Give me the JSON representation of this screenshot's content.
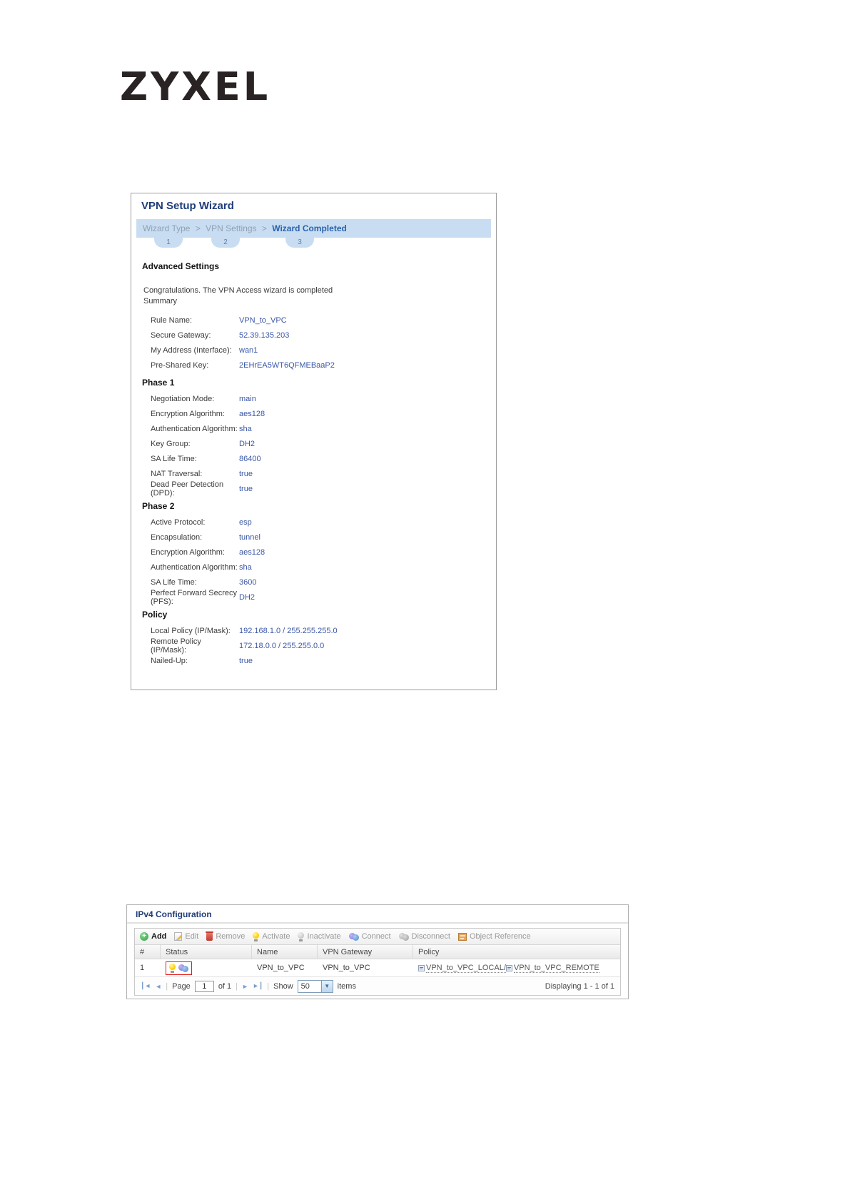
{
  "logo_text": "ZYXEL",
  "colors": {
    "title_navy": "#1e3c78",
    "breadcrumb_bg": "#c8ddf2",
    "breadcrumb_current": "#2a62ac",
    "value_blue": "#3a57a7",
    "status_highlight_red": "#e21b1b"
  },
  "wizard": {
    "title": "VPN Setup Wizard",
    "breadcrumb": {
      "item1": "Wizard Type",
      "item2": "VPN Settings",
      "current": "Wizard Completed",
      "separator": ">"
    },
    "steps": [
      "1",
      "2",
      "3"
    ],
    "advanced_heading": "Advanced Settings",
    "congrats_line1": "Congratulations. The VPN Access wizard is completed",
    "congrats_line2": "Summary",
    "summary": [
      {
        "label": "Rule Name:",
        "value": "VPN_to_VPC"
      },
      {
        "label": "Secure Gateway:",
        "value": "52.39.135.203"
      },
      {
        "label": "My Address (Interface):",
        "value": "wan1"
      },
      {
        "label": "Pre-Shared Key:",
        "value": "2EHrEA5WT6QFMEBaaP2"
      }
    ],
    "phase1": {
      "title": "Phase 1",
      "rows": [
        {
          "label": "Negotiation Mode:",
          "value": "main"
        },
        {
          "label": "Encryption Algorithm:",
          "value": "aes128"
        },
        {
          "label": "Authentication Algorithm:",
          "value": "sha"
        },
        {
          "label": "Key Group:",
          "value": "DH2"
        },
        {
          "label": "SA Life Time:",
          "value": "86400"
        },
        {
          "label": "NAT Traversal:",
          "value": "true"
        },
        {
          "label": "Dead Peer Detection (DPD):",
          "value": "true"
        }
      ]
    },
    "phase2": {
      "title": "Phase 2",
      "rows": [
        {
          "label": "Active Protocol:",
          "value": "esp"
        },
        {
          "label": "Encapsulation:",
          "value": "tunnel"
        },
        {
          "label": "Encryption Algorithm:",
          "value": "aes128"
        },
        {
          "label": "Authentication Algorithm:",
          "value": "sha"
        },
        {
          "label": "SA Life Time:",
          "value": "3600"
        },
        {
          "label": "Perfect Forward Secrecy (PFS):",
          "value": "DH2"
        }
      ]
    },
    "policy": {
      "title": "Policy",
      "rows": [
        {
          "label": "Local Policy (IP/Mask):",
          "value": "192.168.1.0 / 255.255.255.0"
        },
        {
          "label": "Remote Policy (IP/Mask):",
          "value": "172.18.0.0 / 255.255.0.0"
        },
        {
          "label": "Nailed-Up:",
          "value": "true"
        }
      ]
    }
  },
  "ipv4": {
    "title": "IPv4 Configuration",
    "toolbar": [
      {
        "label": "Add",
        "icon": "add-icon",
        "enabled": true
      },
      {
        "label": "Edit",
        "icon": "edit-icon",
        "enabled": false
      },
      {
        "label": "Remove",
        "icon": "trash-icon",
        "enabled": false
      },
      {
        "label": "Activate",
        "icon": "lightbulb-on-icon",
        "enabled": false
      },
      {
        "label": "Inactivate",
        "icon": "lightbulb-off-icon",
        "enabled": false
      },
      {
        "label": "Connect",
        "icon": "connect-icon",
        "enabled": false
      },
      {
        "label": "Disconnect",
        "icon": "disconnect-icon",
        "enabled": false
      },
      {
        "label": "Object Reference",
        "icon": "object-reference-icon",
        "enabled": false
      }
    ],
    "table": {
      "columns": [
        "#",
        "Status",
        "Name",
        "VPN Gateway",
        "Policy"
      ],
      "rows": [
        {
          "num": "1",
          "name": "VPN_to_VPC",
          "gateway": "VPN_to_VPC",
          "policy_local": "VPN_to_VPC_LOCAL/",
          "policy_remote": "VPN_to_VPC_REMOTE"
        }
      ]
    },
    "pagination": {
      "page_label": "Page",
      "page_value": "1",
      "of_label": "of 1",
      "show_label": "Show",
      "show_value": "50",
      "items_label": "items",
      "displaying": "Displaying 1 - 1 of 1"
    }
  }
}
